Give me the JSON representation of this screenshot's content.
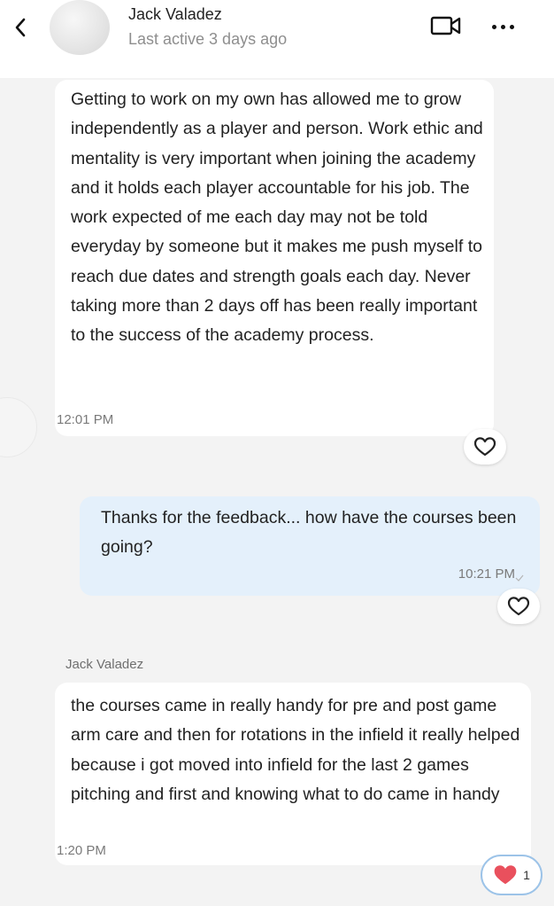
{
  "header": {
    "contact_name": "Jack Valadez",
    "last_active": "Last active 3 days ago",
    "icons": [
      "chevron-left-icon",
      "video-camera-icon",
      "more-icon"
    ]
  },
  "messages": [
    {
      "direction": "incoming",
      "text": "Getting to work on my own has allowed me to grow independently as a player and person. Work ethic and mentality is very important when joining the academy and it holds each player accountable for his job. The work expected of me each day may not be told everyday by someone but it makes me push myself to reach due dates and strength goals each day. Never taking more than 2 days off has been really important to the success of the academy process.",
      "time": "12:01 PM",
      "reaction_icon": "heart-outline-icon"
    },
    {
      "direction": "outgoing",
      "text": "Thanks for the feedback... how have the courses been going?",
      "time": "10:21 PM",
      "status_icon": "checkmark-icon",
      "reaction_icon": "heart-outline-icon"
    },
    {
      "direction": "incoming",
      "sender": "Jack Valadez",
      "text": "the courses came in really handy for pre and post game arm care and then for rotations in the infield it really helped because i got moved into infield for the last 2 games pitching and first and knowing what to do came in handy",
      "time": "1:20 PM",
      "reaction_icon": "heart-filled-icon",
      "reaction_count": "1"
    }
  ],
  "colors": {
    "background": "#f3f3f3",
    "incoming_bubble": "#ffffff",
    "outgoing_bubble": "#e4f0fb",
    "heart_filled": "#e9505d",
    "like_border": "#9cc3e8"
  }
}
